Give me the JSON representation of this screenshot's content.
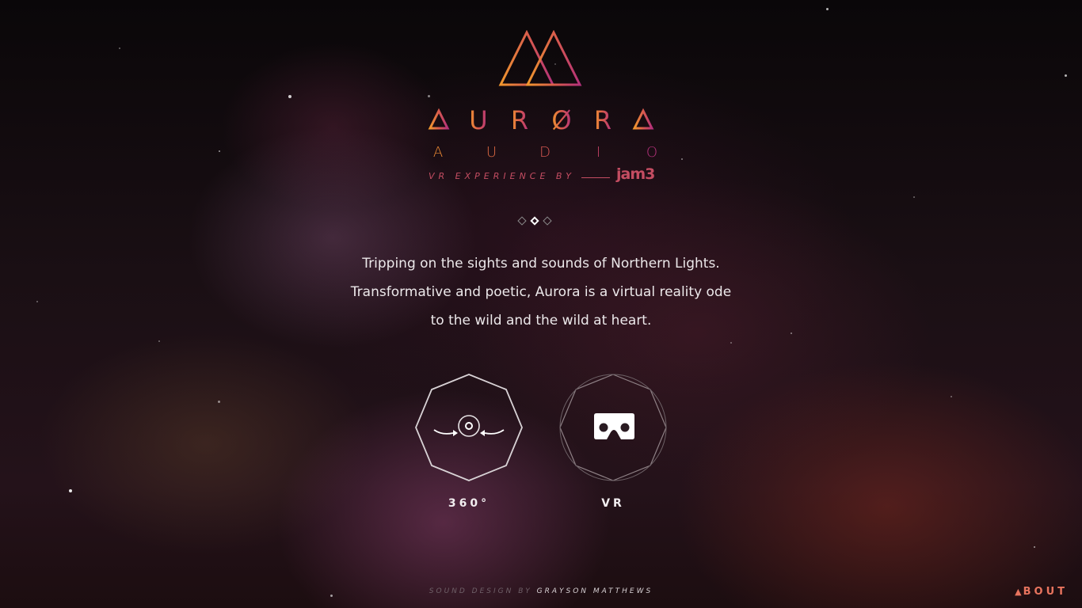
{
  "brand": {
    "wordmark_letters": [
      "A",
      "U",
      "R",
      "Ø",
      "R",
      "A"
    ],
    "sub_letters": [
      "A",
      "U",
      "D",
      "I",
      "O"
    ],
    "tagline": "VR EXPERIENCE BY",
    "partner": "jam3",
    "colors": {
      "gradient_start": "#f0962e",
      "gradient_mid": "#d85a4e",
      "gradient_end": "#b4317a"
    }
  },
  "pager": {
    "count": 3,
    "active_index": 1
  },
  "description": {
    "lines": [
      "Tripping on the sights and sounds of Northern Lights.",
      "Transformative and poetic, Aurora is a virtual reality ode",
      "to the wild and the wild at heart."
    ]
  },
  "modes": [
    {
      "label": "360°",
      "icon": "360-rotate-icon"
    },
    {
      "label": "VR",
      "icon": "vr-headset-icon"
    }
  ],
  "footer": {
    "prefix": "SOUND DESIGN BY",
    "credit": "GRAYSON MATTHEWS"
  },
  "about": {
    "triangle": "▲",
    "label": "BOUT"
  }
}
